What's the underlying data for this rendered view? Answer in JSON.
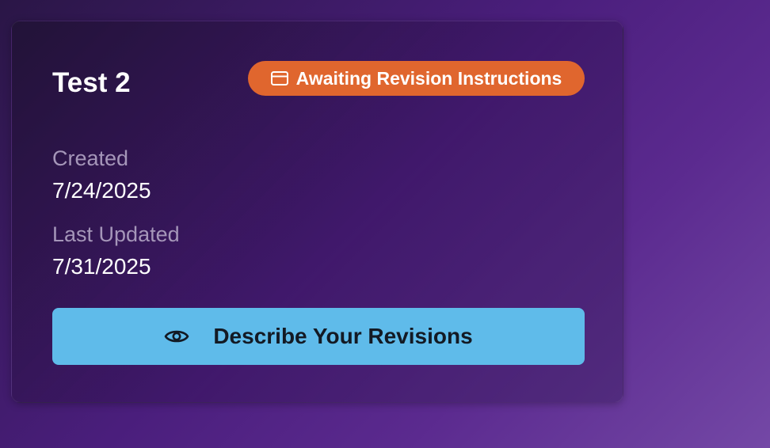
{
  "card": {
    "title": "Test 2",
    "status": {
      "label": "Awaiting Revision Instructions",
      "icon": "credit-card-icon",
      "color": "#e0662e"
    },
    "created": {
      "label": "Created",
      "value": "7/24/2025"
    },
    "last_updated": {
      "label": "Last Updated",
      "value": "7/31/2025"
    },
    "action": {
      "label": "Describe Your Revisions",
      "icon": "eye-icon",
      "color": "#5fbbea"
    }
  }
}
